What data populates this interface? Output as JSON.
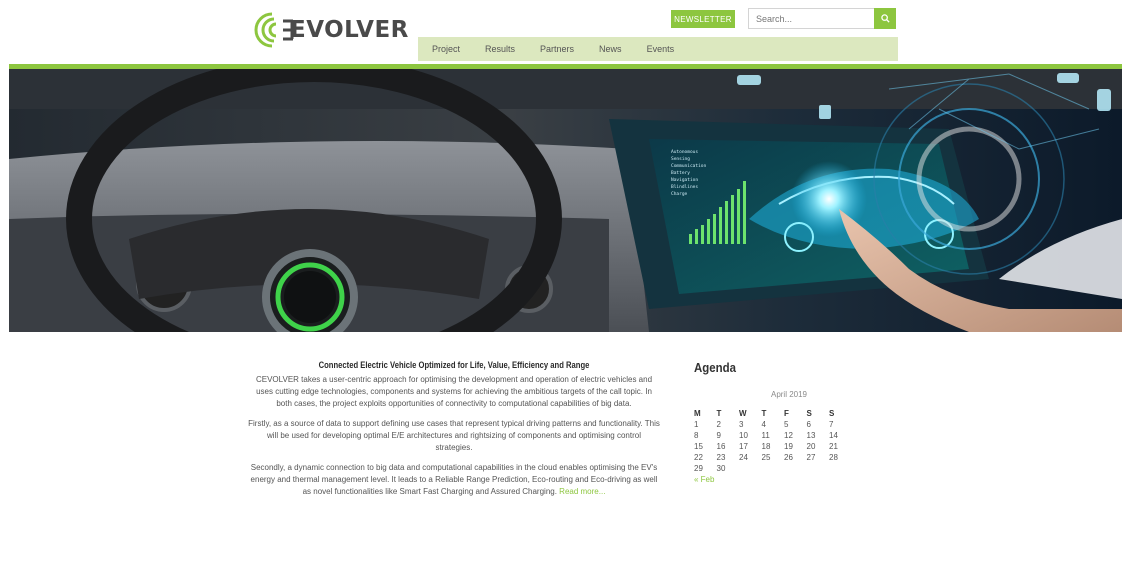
{
  "header": {
    "logo_text": "EVOLVER",
    "newsletter_label": "NEWSLETTER",
    "search_placeholder": "Search...",
    "nav": [
      "Project",
      "Results",
      "Partners",
      "News",
      "Events"
    ]
  },
  "hero": {
    "hud_lines": [
      "Autonomous",
      "Sensing",
      "Communication",
      "Battery",
      "Navigation",
      "Blindlines",
      "Charge"
    ]
  },
  "intro": {
    "title": "Connected Electric Vehicle Optimized for Life, Value, Efficiency and Range",
    "paragraphs": [
      "CEVOLVER takes a user-centric approach for optimising the development and operation of electric vehicles and uses cutting edge technologies, components and systems for achieving the ambitious targets of the call topic. In both cases, the project exploits opportunities of connectivity to computational capabilities of big data.",
      "Firstly, as a source of data to support defining use cases that represent typical driving patterns and functionality. This will be used for developing optimal E/E architectures and rightsizing of components and optimising control strategies.",
      "Secondly, a dynamic connection to big data and computational capabilities in the cloud enables optimising the EV's energy and thermal management level. It leads to a Reliable Range Prediction, Eco-routing and Eco-driving as well as novel functionalities like Smart Fast Charging and Assured Charging."
    ],
    "read_more": "Read more..."
  },
  "agenda": {
    "title": "Agenda",
    "month": "April 2019",
    "weekdays": [
      "M",
      "T",
      "W",
      "T",
      "F",
      "S",
      "S"
    ],
    "weeks": [
      [
        "1",
        "2",
        "3",
        "4",
        "5",
        "6",
        "7"
      ],
      [
        "8",
        "9",
        "10",
        "11",
        "12",
        "13",
        "14"
      ],
      [
        "15",
        "16",
        "17",
        "18",
        "19",
        "20",
        "21"
      ],
      [
        "22",
        "23",
        "24",
        "25",
        "26",
        "27",
        "28"
      ],
      [
        "29",
        "30",
        "",
        "",
        "",
        "",
        ""
      ]
    ],
    "prev_link": "« Feb"
  },
  "colors": {
    "accent": "#8dc63f",
    "nav_bg": "#dce8bf"
  }
}
